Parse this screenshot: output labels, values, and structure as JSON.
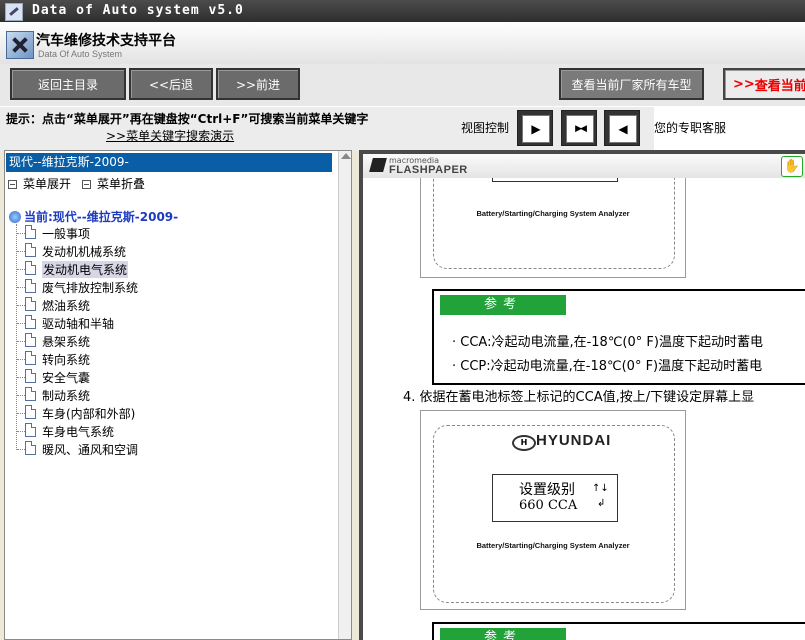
{
  "window": {
    "title": "Data of Auto system v5.0"
  },
  "header": {
    "app_name": "汽车维修技术支持平台",
    "app_subtitle": "Data Of Auto System"
  },
  "toolbar": {
    "back_main": "返回主目录",
    "back": "<<后退",
    "forward": ">>前进",
    "all_models": "查看当前厂家所有车型",
    "view_current": "查看当前"
  },
  "hint": {
    "text": "提示：点击“菜单展开”再在键盘按“Ctrl+F”可搜索当前菜单关键字",
    "demo_link": ">>菜单关键字搜索演示",
    "view_control": "视图控制",
    "exclusive_service": "您的专职客服"
  },
  "left": {
    "selected_model": "现代--维拉克斯-2009-",
    "expand_label": "菜单展开",
    "collapse_label": "菜单折叠",
    "current_label": "当前:现代--维拉克斯-2009-",
    "items": [
      "一般事项",
      "发动机机械系统",
      "发动机电气系统",
      "废气排放控制系统",
      "燃油系统",
      "驱动轴和半轴",
      "悬架系统",
      "转向系统",
      "安全气囊",
      "制动系统",
      "车身(内部和外部)",
      "车身电气系统",
      "暖风、通风和空调"
    ],
    "selected_index": 2
  },
  "viewer": {
    "brand_top": "macromedia",
    "brand_name": "FLASHPAPER",
    "fig1_caption": "Battery/Starting/Charging System Analyzer",
    "note_title": "参考",
    "note_cca": "· CCA:冷起动电流量,在-18℃(0° F)温度下起动时蓄电",
    "note_ccp": "· CCP:冷起动电流量,在-18℃(0° F)温度下起动时蓄电",
    "step4": "4. 依据在蓄电池标签上标记的CCA值,按上/下键设定屏幕上显",
    "fig2_brand": "HYUNDAI",
    "fig2_screen_line1": "设置级别",
    "fig2_screen_line2": "660 CCA",
    "fig2_screen_arrows": "↑↓",
    "fig2_screen_enter": "↲",
    "fig2_caption": "Battery/Starting/Charging System Analyzer",
    "note2_title": "参考"
  }
}
